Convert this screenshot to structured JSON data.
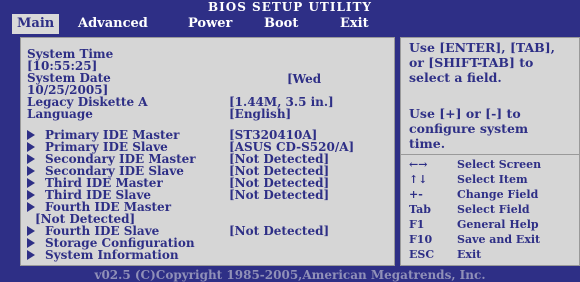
{
  "title": "BIOS SETUP UTILITY",
  "tabs": [
    "Main",
    "Advanced",
    "Power",
    "Boot",
    "Exit"
  ],
  "active_tab": "Main",
  "main": {
    "system_time_label": "System Time",
    "system_time_value": "[10:55:25]",
    "system_date_label": "System Date",
    "system_date_value_part1": "[Wed",
    "system_date_value_part2": "10/25/2005]",
    "legacy_diskette_label": "Legacy Diskette A",
    "legacy_diskette_value": "[1.44M, 3.5 in.]",
    "language_label": "Language",
    "language_value": "[English]",
    "submenus": [
      {
        "label": "Primary IDE Master",
        "value": "[ST320410A]"
      },
      {
        "label": "Primary IDE Slave",
        "value": "[ASUS CD-S520/A]"
      },
      {
        "label": "Secondary IDE Master",
        "value": "[Not Detected]"
      },
      {
        "label": "Secondary IDE Slave",
        "value": "[Not Detected]"
      },
      {
        "label": "Third IDE Master",
        "value": "[Not Detected]"
      },
      {
        "label": "Third IDE Slave",
        "value": "[Not Detected]"
      },
      {
        "label": "Fourth IDE Master",
        "value": "[Not Detected]"
      },
      {
        "label": "Fourth IDE Slave",
        "value": "[Not Detected]"
      },
      {
        "label": "Storage Configuration",
        "value": ""
      },
      {
        "label": "System Information",
        "value": ""
      }
    ]
  },
  "help": {
    "lines": [
      "Use [ENTER], [TAB],",
      "or [SHIFT-TAB] to",
      "select a field.",
      "Use  [+] or [-] to",
      "configure system",
      "time."
    ],
    "keys": [
      {
        "key": "←→",
        "desc": "Select Screen"
      },
      {
        "key": "↑↓",
        "desc": "Select Item"
      },
      {
        "key": "+-",
        "desc": "Change Field"
      },
      {
        "key": "Tab",
        "desc": "Select Field"
      },
      {
        "key": "F1",
        "desc": "General Help"
      },
      {
        "key": "F10",
        "desc": "Save and Exit"
      },
      {
        "key": "ESC",
        "desc": "Exit"
      }
    ]
  },
  "footer": "v02.5 (C)Copyright 1985-2005,American Megatrends, Inc.",
  "colors": {
    "background": "#2e2f86",
    "panel": "#d6d6d6",
    "text": "#2e2f86"
  }
}
